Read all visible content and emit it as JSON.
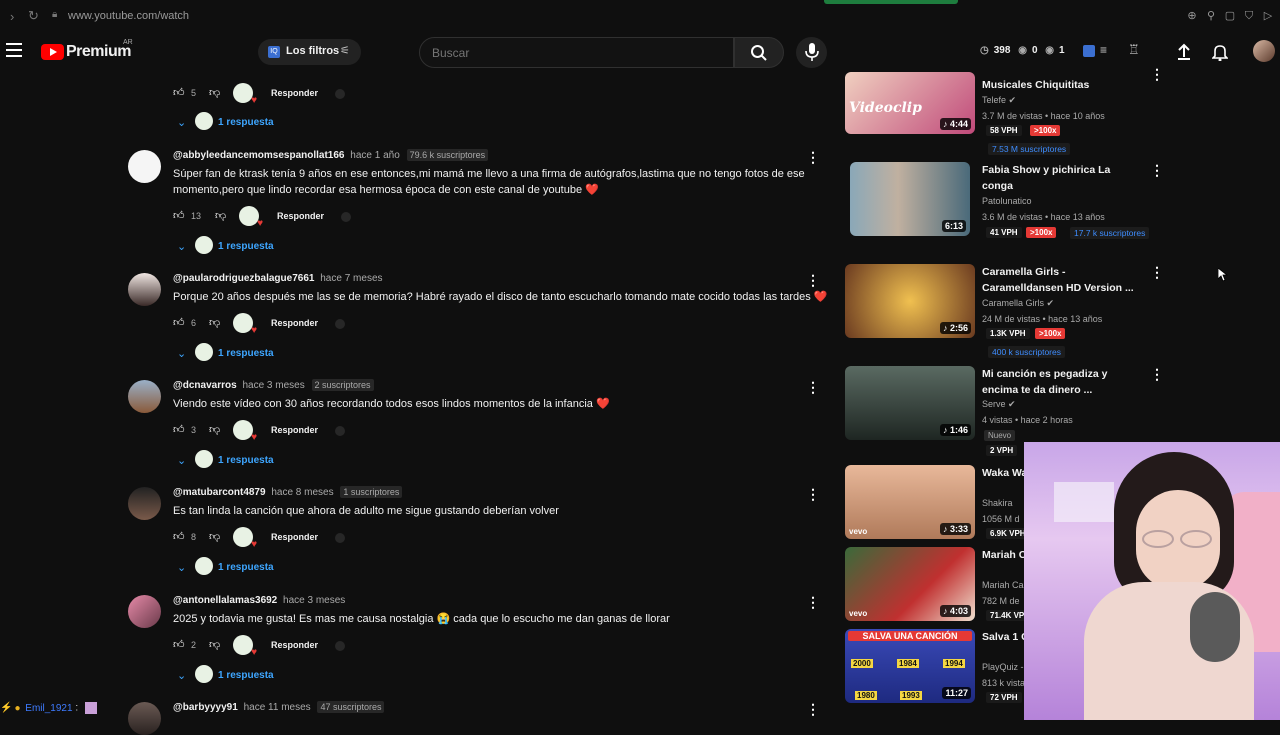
{
  "browser": {
    "url": "www.youtube.com/watch"
  },
  "header": {
    "logo_text": "Premium",
    "logo_country": "AR",
    "filters_label": "Los filtros",
    "search_placeholder": "Buscar",
    "stats": [
      "398",
      "0",
      "1"
    ]
  },
  "comments": [
    {
      "likes": "5",
      "reply_label": "Responder",
      "replies_label": "1 respuesta"
    },
    {
      "author": "@abbyleedancemomsespanollat166",
      "time": "hace 1 año",
      "badge": "79.6 k suscriptores",
      "text": "Súper fan de ktrask tenía 9 años en ese entonces,mi mamá me llevo a una firma de autógrafos,lastima que no tengo fotos de ese momento,pero que lindo recordar esa hermosa época de con este canal de youtube ❤️",
      "likes": "13",
      "reply_label": "Responder",
      "replies_label": "1 respuesta"
    },
    {
      "author": "@paularodriguezbalague7661",
      "time": "hace 7 meses",
      "badge": "",
      "text": "Porque 20 años después me las se de memoria? Habré rayado el disco de tanto escucharlo tomando mate cocido todas las tardes ❤️",
      "likes": "6",
      "reply_label": "Responder",
      "replies_label": "1 respuesta"
    },
    {
      "author": "@dcnavarros",
      "time": "hace 3 meses",
      "badge": "2 suscriptores",
      "text": "Viendo este vídeo con 30 años recordando todos esos lindos momentos de la infancia ❤️",
      "likes": "3",
      "reply_label": "Responder",
      "replies_label": "1 respuesta"
    },
    {
      "author": "@matubarcont4879",
      "time": "hace 8 meses",
      "badge": "1 suscriptores",
      "text": "Es tan linda la canción que ahora de adulto me sigue gustando deberían volver",
      "likes": "8",
      "reply_label": "Responder",
      "replies_label": "1 respuesta"
    },
    {
      "author": "@antonellalamas3692",
      "time": "hace 3 meses",
      "badge": "",
      "text": "2025 y todavia me gusta! Es mas me causa nostalgia 😭 cada que lo escucho me dan ganas de llorar",
      "likes": "2",
      "reply_label": "Responder",
      "replies_label": "1 respuesta"
    },
    {
      "author": "@barbyyyy91",
      "time": "hace 11 meses",
      "badge": "47 suscriptores"
    }
  ],
  "videos": [
    {
      "title": "Musicales Chiquititas",
      "channel": "Telefe",
      "meta": "3.7 M de vistas • hace 10 años",
      "vph": "58 VPH",
      "pct": ">100x",
      "subs": "7.53 M suscriptores",
      "duration": "4:44",
      "thumb_text": "Videoclip",
      "thumb_color": "#c04a7a"
    },
    {
      "title": "Fabia Show y pichirica   La conga",
      "channel": "Patolunatico",
      "meta": "3.6 M de vistas • hace 13 años",
      "vph": "41 VPH",
      "pct": ">100x",
      "subs": "17.7 k suscriptores",
      "duration": "6:13",
      "thumb_color": "#6a8a9a"
    },
    {
      "title": "Caramella Girls - Caramelldansen HD Version ...",
      "channel": "Caramella Girls",
      "meta": "24 M de vistas • hace 13 años",
      "vph": "1.3K VPH",
      "pct": ">100x",
      "subs": "400 k suscriptores",
      "duration": "2:56",
      "thumb_color": "#d8a12a"
    },
    {
      "title": "Mi canción es pegadiza y encima te da dinero ...",
      "channel": "Serve",
      "meta": "4 vistas • hace 2 horas",
      "new_label": "Nuevo",
      "vph": "2 VPH",
      "duration": "1:46",
      "thumb_color": "#3d4a44"
    },
    {
      "title": "Waka Wa (Cancion",
      "channel": "Shakira",
      "meta": "1056 M d",
      "vph": "6.9K VPH",
      "duration": "3:33",
      "thumb_text": "vevo",
      "thumb_color": "#c9a98a"
    },
    {
      "title": "Mariah C Christma",
      "channel": "Mariah Ca",
      "meta": "782 M de",
      "vph": "71.4K VP",
      "duration": "4:03",
      "thumb_text": "vevo",
      "thumb_color": "#9a2020"
    },
    {
      "title": "Salva 1 C",
      "channel": "PlayQuiz -",
      "meta": "813 k vista",
      "vph": "72 VPH",
      "duration": "11:27",
      "thumb_text": "SALVA UNA CANCIÓN",
      "thumb_color": "#2c3ea8",
      "thumb_years": [
        "2000",
        "1984",
        "1994",
        "1980",
        "1993"
      ]
    }
  ],
  "chat": {
    "user": "Emil_1921",
    "separator": ":"
  }
}
